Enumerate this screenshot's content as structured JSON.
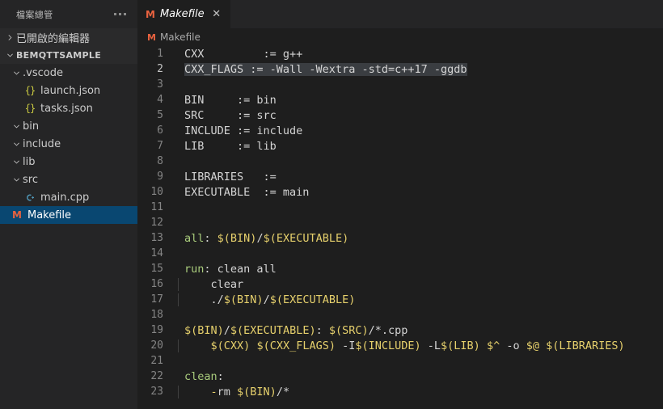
{
  "sidebar": {
    "title": "檔案總管",
    "more_actions": "...",
    "open_editors_label": "已開啟的編輯器",
    "project_label": "BEMQTTSAMPLE",
    "items": [
      {
        "label": ".vscode",
        "kind": "folder",
        "indent": 2,
        "expanded": true,
        "icon": "chevron-down-icon"
      },
      {
        "label": "launch.json",
        "kind": "file",
        "indent": 3,
        "icon": "json-file-icon"
      },
      {
        "label": "tasks.json",
        "kind": "file",
        "indent": 3,
        "icon": "json-file-icon"
      },
      {
        "label": "bin",
        "kind": "folder",
        "indent": 2,
        "expanded": true,
        "icon": "chevron-down-icon"
      },
      {
        "label": "include",
        "kind": "folder",
        "indent": 2,
        "expanded": true,
        "icon": "chevron-down-icon"
      },
      {
        "label": "lib",
        "kind": "folder",
        "indent": 2,
        "expanded": true,
        "icon": "chevron-down-icon"
      },
      {
        "label": "src",
        "kind": "folder",
        "indent": 2,
        "expanded": true,
        "icon": "chevron-down-icon"
      },
      {
        "label": "main.cpp",
        "kind": "file",
        "indent": 3,
        "icon": "cpp-file-icon"
      },
      {
        "label": "Makefile",
        "kind": "file",
        "indent": 2,
        "icon": "makefile-icon",
        "selected": true
      }
    ]
  },
  "tab": {
    "label": "Makefile",
    "icon": "makefile-icon",
    "close_label": "✕",
    "preview": true
  },
  "breadcrumb": {
    "label": "Makefile",
    "icon": "makefile-icon"
  },
  "colors": {
    "editor_bg": "#1e1e1e",
    "sidebar_bg": "#252526",
    "selection_blue": "#094771",
    "text_selection": "#264f78",
    "target_green": "#a9cc7c",
    "variable_yellow": "#e6d06c",
    "plain_text": "#d4d4d4",
    "line_number": "#858585",
    "makefile_icon": "#e8623f",
    "cpp_icon": "#519aba",
    "json_icon": "#cbcb41"
  },
  "editor": {
    "language": "makefile",
    "first_line": 1,
    "current_line": 2,
    "lines": [
      {
        "n": 1,
        "indent": false,
        "selected": false,
        "tokens": [
          {
            "t": "CXX         := g++",
            "c": "plain"
          }
        ]
      },
      {
        "n": 2,
        "indent": false,
        "selected": true,
        "tokens": [
          {
            "t": "CXX_FLAGS := -Wall -Wextra -std=c++17 -ggdb",
            "c": "plain"
          }
        ]
      },
      {
        "n": 3,
        "indent": false,
        "selected": false,
        "tokens": []
      },
      {
        "n": 4,
        "indent": false,
        "selected": false,
        "tokens": [
          {
            "t": "BIN     := bin",
            "c": "plain"
          }
        ]
      },
      {
        "n": 5,
        "indent": false,
        "selected": false,
        "tokens": [
          {
            "t": "SRC     := src",
            "c": "plain"
          }
        ]
      },
      {
        "n": 6,
        "indent": false,
        "selected": false,
        "tokens": [
          {
            "t": "INCLUDE := include",
            "c": "plain"
          }
        ]
      },
      {
        "n": 7,
        "indent": false,
        "selected": false,
        "tokens": [
          {
            "t": "LIB     := lib",
            "c": "plain"
          }
        ]
      },
      {
        "n": 8,
        "indent": false,
        "selected": false,
        "tokens": []
      },
      {
        "n": 9,
        "indent": false,
        "selected": false,
        "tokens": [
          {
            "t": "LIBRARIES   :=",
            "c": "plain"
          }
        ]
      },
      {
        "n": 10,
        "indent": false,
        "selected": false,
        "tokens": [
          {
            "t": "EXECUTABLE  := main",
            "c": "plain"
          }
        ]
      },
      {
        "n": 11,
        "indent": false,
        "selected": false,
        "tokens": []
      },
      {
        "n": 12,
        "indent": false,
        "selected": false,
        "tokens": []
      },
      {
        "n": 13,
        "indent": false,
        "selected": false,
        "tokens": [
          {
            "t": "all",
            "c": "target"
          },
          {
            "t": ": ",
            "c": "plain"
          },
          {
            "t": "$(BIN)",
            "c": "var"
          },
          {
            "t": "/",
            "c": "plain"
          },
          {
            "t": "$(EXECUTABLE)",
            "c": "var"
          }
        ]
      },
      {
        "n": 14,
        "indent": false,
        "selected": false,
        "tokens": []
      },
      {
        "n": 15,
        "indent": false,
        "selected": false,
        "tokens": [
          {
            "t": "run",
            "c": "target"
          },
          {
            "t": ": clean all",
            "c": "plain"
          }
        ]
      },
      {
        "n": 16,
        "indent": true,
        "selected": false,
        "tokens": [
          {
            "t": "    clear",
            "c": "plain"
          }
        ]
      },
      {
        "n": 17,
        "indent": true,
        "selected": false,
        "tokens": [
          {
            "t": "    ./",
            "c": "plain"
          },
          {
            "t": "$(BIN)",
            "c": "var"
          },
          {
            "t": "/",
            "c": "plain"
          },
          {
            "t": "$(EXECUTABLE)",
            "c": "var"
          }
        ]
      },
      {
        "n": 18,
        "indent": true,
        "selected": false,
        "tokens": []
      },
      {
        "n": 19,
        "indent": false,
        "selected": false,
        "tokens": [
          {
            "t": "$(BIN)",
            "c": "var"
          },
          {
            "t": "/",
            "c": "plain"
          },
          {
            "t": "$(EXECUTABLE)",
            "c": "var"
          },
          {
            "t": ": ",
            "c": "plain"
          },
          {
            "t": "$(SRC)",
            "c": "var"
          },
          {
            "t": "/*.cpp",
            "c": "plain"
          }
        ]
      },
      {
        "n": 20,
        "indent": true,
        "selected": false,
        "tokens": [
          {
            "t": "    ",
            "c": "plain"
          },
          {
            "t": "$(CXX)",
            "c": "var"
          },
          {
            "t": " ",
            "c": "plain"
          },
          {
            "t": "$(CXX_FLAGS)",
            "c": "var"
          },
          {
            "t": " -I",
            "c": "plain"
          },
          {
            "t": "$(INCLUDE)",
            "c": "var"
          },
          {
            "t": " -L",
            "c": "plain"
          },
          {
            "t": "$(LIB)",
            "c": "var"
          },
          {
            "t": " ",
            "c": "plain"
          },
          {
            "t": "$^",
            "c": "var"
          },
          {
            "t": " -o ",
            "c": "plain"
          },
          {
            "t": "$@",
            "c": "var"
          },
          {
            "t": " ",
            "c": "plain"
          },
          {
            "t": "$(LIBRARIES)",
            "c": "var"
          }
        ]
      },
      {
        "n": 21,
        "indent": true,
        "selected": false,
        "tokens": []
      },
      {
        "n": 22,
        "indent": false,
        "selected": false,
        "tokens": [
          {
            "t": "clean",
            "c": "target"
          },
          {
            "t": ":",
            "c": "plain"
          }
        ]
      },
      {
        "n": 23,
        "indent": true,
        "selected": false,
        "tokens": [
          {
            "t": "    ",
            "c": "plain"
          },
          {
            "t": "-",
            "c": "var"
          },
          {
            "t": "rm ",
            "c": "plain"
          },
          {
            "t": "$(BIN)",
            "c": "var"
          },
          {
            "t": "/*",
            "c": "plain"
          }
        ]
      }
    ]
  }
}
